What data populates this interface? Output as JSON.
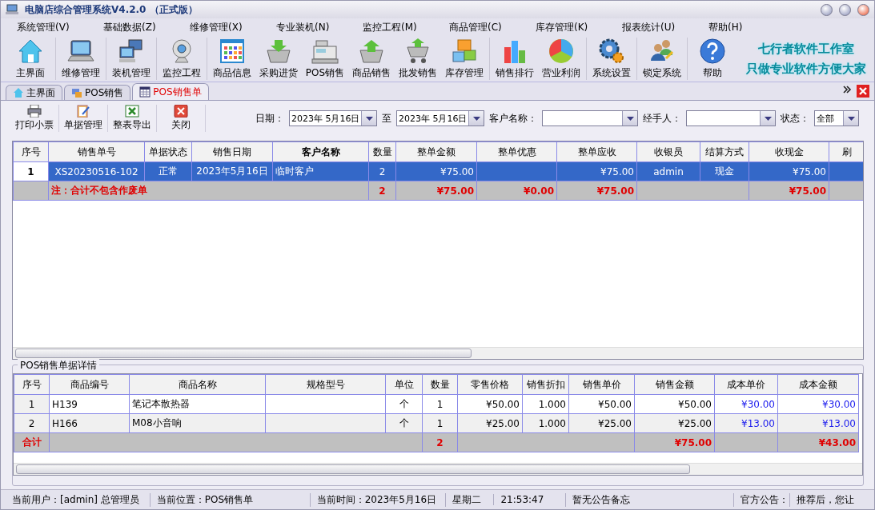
{
  "window": {
    "title": "电脑店综合管理系统V4.2.0 （正式版）"
  },
  "menu": [
    {
      "label": "系统管理(V)"
    },
    {
      "label": "基础数据(Z)"
    },
    {
      "label": "维修管理(X)"
    },
    {
      "label": "专业装机(N)"
    },
    {
      "label": "监控工程(M)"
    },
    {
      "label": "商品管理(C)"
    },
    {
      "label": "库存管理(K)"
    },
    {
      "label": "报表统计(U)"
    },
    {
      "label": "帮助(H)"
    }
  ],
  "toolbar_groups": [
    [
      "主界面"
    ],
    [
      "维修管理"
    ],
    [
      "装机管理"
    ],
    [
      "监控工程"
    ],
    [
      "商品信息",
      "采购进货",
      "POS销售",
      "商品销售",
      "批发销售",
      "库存管理"
    ],
    [
      "销售排行",
      "营业利润"
    ],
    [
      "系统设置"
    ],
    [
      "锁定系统"
    ],
    [
      "帮助"
    ]
  ],
  "slogan": [
    "七行者软件工作室",
    "只做专业软件方便大家"
  ],
  "tabs": [
    {
      "label": "主界面",
      "selected": false
    },
    {
      "label": "POS销售",
      "selected": false
    },
    {
      "label": "POS销售单",
      "selected": true
    }
  ],
  "actions": [
    "打印小票",
    "单据管理",
    "整表导出",
    "关闭"
  ],
  "filters": {
    "date_label": "日期：",
    "date_from": "2023年 5月16日",
    "to_label": "至",
    "date_to": "2023年 5月16日",
    "customer_label": "客户名称：",
    "handler_label": "经手人：",
    "status_label": "状态：",
    "status_value": "全部"
  },
  "orders": {
    "columns": [
      {
        "label": "序号",
        "sorted": false
      },
      {
        "label": "销售单号",
        "sorted": false
      },
      {
        "label": "单据状态",
        "sorted": false
      },
      {
        "label": "销售日期",
        "sorted": false
      },
      {
        "label": "客户名称",
        "sorted": true
      },
      {
        "label": "数量",
        "sorted": false
      },
      {
        "label": "整单金额",
        "sorted": false
      },
      {
        "label": "整单优惠",
        "sorted": false
      },
      {
        "label": "整单应收",
        "sorted": false
      },
      {
        "label": "收银员",
        "sorted": false
      },
      {
        "label": "结算方式",
        "sorted": false
      },
      {
        "label": "收现金",
        "sorted": false
      },
      {
        "label": "刷",
        "sorted": false
      }
    ],
    "rows": [
      {
        "selected": true,
        "cells": [
          "1",
          "XS20230516-102",
          "正常",
          "2023年5月16日",
          "临时客户",
          "2",
          "¥75.00",
          null,
          "¥75.00",
          "admin",
          "现金",
          "¥75.00",
          null
        ]
      }
    ],
    "totals": {
      "note": "注：合计不包含作废单",
      "quantity": "2",
      "amount": "¥75.00",
      "discount": "¥0.00",
      "receivable": "¥75.00",
      "cash": "¥75.00"
    }
  },
  "details": {
    "title": "POS销售单据详情",
    "columns": [
      "序号",
      "商品编号",
      "商品名称",
      "规格型号",
      "单位",
      "数量",
      "零售价格",
      "销售折扣",
      "销售单价",
      "销售金额",
      "成本单价",
      "成本金额"
    ],
    "rows": [
      [
        "1",
        "H139",
        "笔记本散热器",
        null,
        "个",
        "1",
        "¥50.00",
        "1.000",
        "¥50.00",
        "¥50.00",
        "¥30.00",
        "¥30.00"
      ],
      [
        "2",
        "H166",
        "M08小音响",
        null,
        "个",
        "1",
        "¥25.00",
        "1.000",
        "¥25.00",
        "¥25.00",
        "¥13.00",
        "¥13.00"
      ]
    ],
    "totals": {
      "label": "合计",
      "quantity": "2",
      "sales_amount": "¥75.00",
      "cost_amount": "¥43.00"
    }
  },
  "status_bar": [
    "当前用户：[admin] 总管理员",
    "当前位置：POS销售单",
    "当前时间：2023年5月16日",
    "星期二",
    "21:53:47",
    "暂无公告备忘",
    "官方公告：",
    "推荐后，您让"
  ]
}
